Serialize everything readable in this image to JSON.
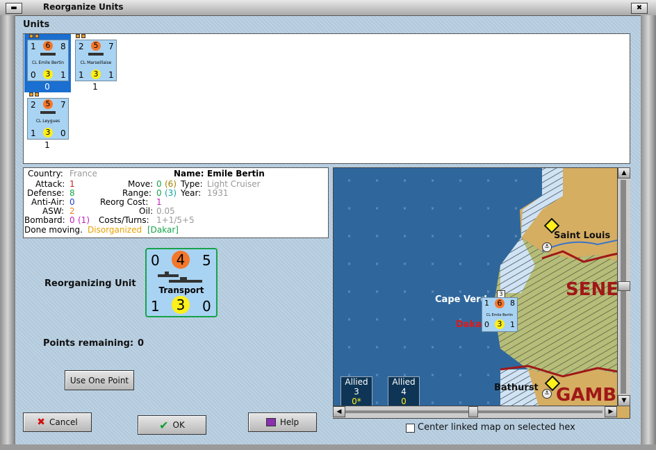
{
  "window": {
    "title": "Reorganize Units",
    "min_label": "▬",
    "close_label": "✖"
  },
  "units_section": {
    "label": "Units",
    "counters": [
      {
        "attack_left": "1",
        "top_circle": "6",
        "right": "8",
        "name": "CL Emile Bertin",
        "bot_left": "0",
        "bot_circle": "3",
        "bot_right": "1",
        "count": "0",
        "selected": true
      },
      {
        "attack_left": "2",
        "top_circle": "5",
        "right": "7",
        "name": "CL Marseillaise",
        "bot_left": "1",
        "bot_circle": "3",
        "bot_right": "1",
        "count": "1",
        "selected": false
      },
      {
        "attack_left": "2",
        "top_circle": "5",
        "right": "7",
        "name": "CL Leygues",
        "bot_left": "1",
        "bot_circle": "3",
        "bot_right": "0",
        "count": "1",
        "selected": false
      }
    ]
  },
  "info": {
    "country_label": "Country:",
    "country": "France",
    "attack_label": "Attack:",
    "attack": "1",
    "defense_label": "Defense:",
    "defense": "8",
    "antiair_label": "Anti-Air:",
    "antiair": "0",
    "asw_label": "ASW:",
    "asw": "2",
    "bombard_label": "Bombard:",
    "bombard": "0",
    "bombard_paren": "(1)",
    "name_label": "Name:",
    "name": "Emile Bertin",
    "move_label": "Move:",
    "move": "0",
    "move_paren": "(6)",
    "type_label": "Type:",
    "type": "Light Cruiser",
    "range_label": "Range:",
    "range": "0",
    "range_paren": "(3)",
    "year_label": "Year:",
    "year": "1931",
    "reorg_label": "Reorg Cost:",
    "reorg": "1",
    "oil_label": "Oil:",
    "oil": "0.05",
    "costs_label": "Costs/Turns:",
    "costs": "1+1/5+5",
    "status_plain": "Done moving.",
    "status_disorg": "Disorganized",
    "status_loc": "[Dakar]"
  },
  "reorg": {
    "label": "Reorganizing Unit",
    "counter": {
      "left": "0",
      "top_circle": "4",
      "right": "5",
      "name": "Transport",
      "bot_left": "1",
      "bot_circle": "3",
      "bot_right": "0"
    },
    "points_label": "Points remaining:",
    "points": "0",
    "use_point_button": "Use One Point"
  },
  "buttons": {
    "cancel": "Cancel",
    "ok": "OK",
    "help": "Help"
  },
  "map": {
    "labels": {
      "saint_louis": "Saint Louis",
      "cape_verde": "Cape Verd",
      "dakar": "Daka",
      "bathurst": "Bathurst",
      "sene": "SENE",
      "gamb": "GAMB"
    },
    "stack_count": "3",
    "map_counter": {
      "left": "1",
      "top_circle": "6",
      "right": "8",
      "name": "CL Emile Bertin",
      "bot_left": "0",
      "bot_circle": "3",
      "bot_right": "1"
    },
    "allied_boxes": [
      {
        "label": "Allied",
        "value": "3",
        "sub": "0*"
      },
      {
        "label": "Allied",
        "value": "4",
        "sub": "0"
      }
    ],
    "center_checkbox_label": "Center linked map on selected hex",
    "center_checked": false
  },
  "colors": {
    "selected": "#1a6fd0",
    "orange_circle": "#f4772b",
    "yellow_circle": "#ffef1a",
    "ocean": "#2f679d",
    "land": "#c8a85c",
    "red_text": "#c81e1e"
  }
}
